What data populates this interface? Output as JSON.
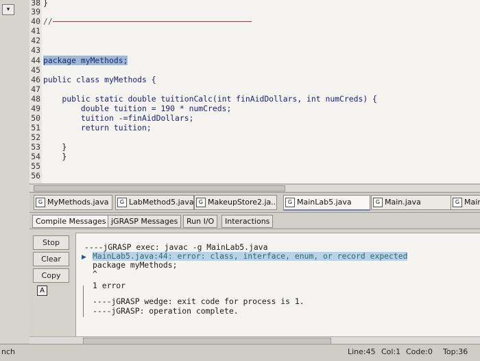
{
  "editor": {
    "lines": [
      {
        "n": "38",
        "code": "}"
      },
      {
        "n": "39",
        "code": ""
      },
      {
        "n": "40",
        "code": "//"
      },
      {
        "n": "41",
        "code": ""
      },
      {
        "n": "42",
        "code": ""
      },
      {
        "n": "43",
        "code": ""
      },
      {
        "n": "44",
        "code": "package myMethods;"
      },
      {
        "n": "45",
        "code": ""
      },
      {
        "n": "46",
        "code": "public class myMethods {"
      },
      {
        "n": "47",
        "code": ""
      },
      {
        "n": "48",
        "code": "    public static double tuitionCalc(int finAidDollars, int numCreds) {"
      },
      {
        "n": "49",
        "code": "        double tuition = 190 * numCreds;"
      },
      {
        "n": "50",
        "code": "        tuition -=finAidDollars;"
      },
      {
        "n": "51",
        "code": "        return tuition;"
      },
      {
        "n": "52",
        "code": ""
      },
      {
        "n": "53",
        "code": "    }"
      },
      {
        "n": "54",
        "code": "    }"
      },
      {
        "n": "55",
        "code": ""
      },
      {
        "n": "56",
        "code": ""
      }
    ]
  },
  "file_tabs": [
    "MyMethods.java",
    "LabMethod5.java",
    "MakeupStore2.ja...",
    "MainLab5.java",
    "Main.java",
    "Main."
  ],
  "message_tabs": [
    "Compile Messages",
    "jGRASP Messages",
    "Run I/O",
    "Interactions"
  ],
  "buttons": {
    "stop": "Stop",
    "clear": "Clear",
    "copy": "Copy",
    "a": "A"
  },
  "messages": {
    "exec": "----jGRASP exec: javac -g MainLab5.java",
    "error": "MainLab5.java:44: error: class, interface, enum, or record expected",
    "source": "package myMethods;",
    "caret": "^",
    "count": "1 error",
    "wedge": "----jGRASP wedge: exit code for process is 1.",
    "complete": "----jGRASP: operation complete."
  },
  "status": {
    "left": "nch",
    "line": "Line:45",
    "col": "Col:1",
    "code": "Code:0",
    "top": "Top:36"
  }
}
